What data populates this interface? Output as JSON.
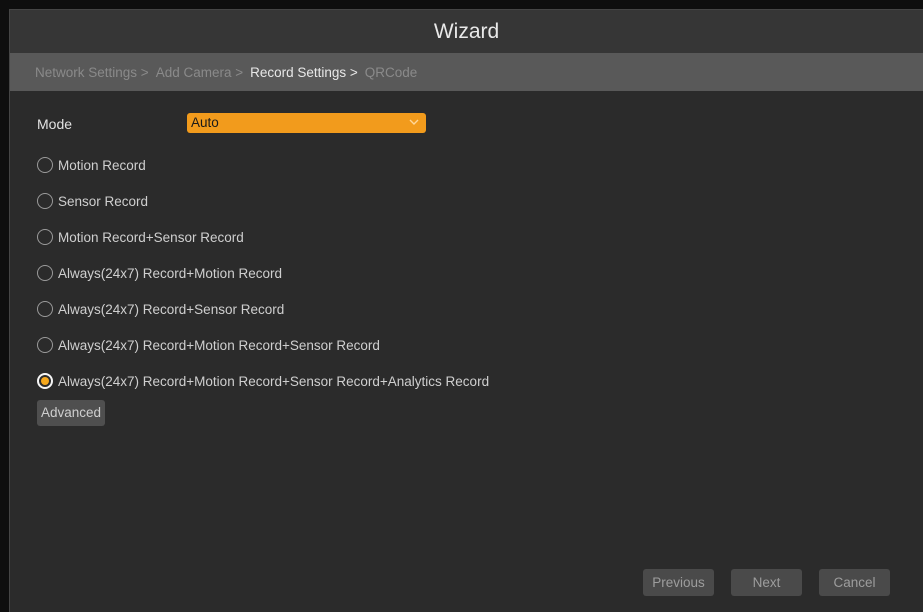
{
  "window": {
    "title": "Wizard"
  },
  "steps": [
    {
      "label": "Network Settings >",
      "active": false
    },
    {
      "label": "Add Camera >",
      "active": false
    },
    {
      "label": "Record Settings >",
      "active": true
    },
    {
      "label": "QRCode",
      "active": false
    }
  ],
  "mode": {
    "label": "Mode",
    "value": "Auto",
    "accent_color": "#f29b1c"
  },
  "record_options": [
    {
      "label": "Motion Record",
      "selected": false
    },
    {
      "label": "Sensor Record",
      "selected": false
    },
    {
      "label": "Motion Record+Sensor Record",
      "selected": false
    },
    {
      "label": "Always(24x7) Record+Motion Record",
      "selected": false
    },
    {
      "label": "Always(24x7) Record+Sensor Record",
      "selected": false
    },
    {
      "label": "Always(24x7) Record+Motion Record+Sensor Record",
      "selected": false
    },
    {
      "label": "Always(24x7) Record+Motion Record+Sensor Record+Analytics Record",
      "selected": true
    }
  ],
  "buttons": {
    "advanced": "Advanced",
    "previous": "Previous",
    "next": "Next",
    "cancel": "Cancel"
  }
}
